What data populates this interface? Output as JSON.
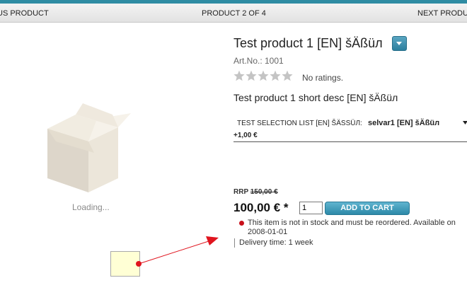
{
  "nav": {
    "prev": "US PRODUCT",
    "counter": "PRODUCT 2 OF 4",
    "next": "NEXT PRODUCT"
  },
  "image": {
    "loading": "Loading..."
  },
  "product": {
    "title": "Test product 1 [EN] šÄßüл",
    "art_no": "Art.No.: 1001",
    "ratings_text": "No ratings.",
    "short_desc": "Test product 1 short desc [EN] šÄßüл"
  },
  "selection": {
    "label": "TEST SELECTION LIST [EN] ŠÄSSÜЛ:",
    "value": "selvar1 [EN] šÄßüл",
    "price": "+1,00 €"
  },
  "pricing": {
    "rrp_label": "RRP",
    "rrp_value": "150,00 €",
    "price": "100,00 € *",
    "qty": "1",
    "add_to_cart": "ADD TO CART"
  },
  "stock": {
    "message": "This item is not in stock and must be reordered. Available on 2008-01-01",
    "delivery": "Delivery time: 1 week",
    "status_color": "#c8101b"
  },
  "colors": {
    "accent": "#2f8ca3",
    "arrow": "#e0141e"
  }
}
